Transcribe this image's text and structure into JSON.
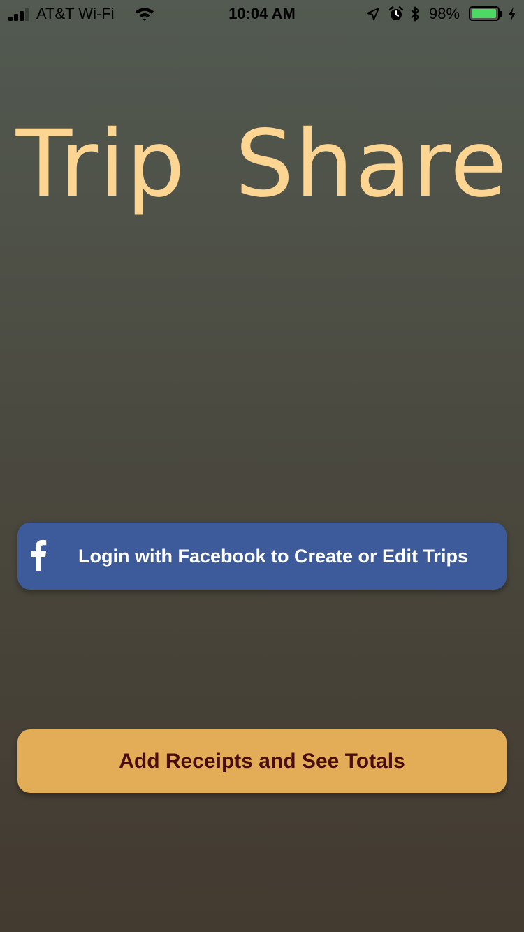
{
  "status_bar": {
    "carrier": "AT&T Wi-Fi",
    "time": "10:04 AM",
    "battery_percent_label": "98%",
    "battery_level": 0.98,
    "signal_bars_active": 3,
    "signal_bars_total": 4,
    "icons": [
      "signal-icon",
      "wifi-icon",
      "location-icon",
      "alarm-icon",
      "bluetooth-icon",
      "battery-icon",
      "charging-icon"
    ]
  },
  "app": {
    "title": "Trip Share"
  },
  "buttons": {
    "facebook_login": {
      "label": "Login with Facebook to Create or Edit Trips",
      "icon": "facebook-icon"
    },
    "add_receipts": {
      "label": "Add Receipts and See Totals"
    }
  },
  "colors": {
    "title": "#fcd592",
    "facebook_button": "#3d5a9a",
    "facebook_text": "#ffffff",
    "receipts_button": "#e3ad58",
    "receipts_text": "#4a0c0c",
    "battery_fill": "#4cd964",
    "background_top": "#525a51",
    "background_bottom": "#433a30"
  }
}
